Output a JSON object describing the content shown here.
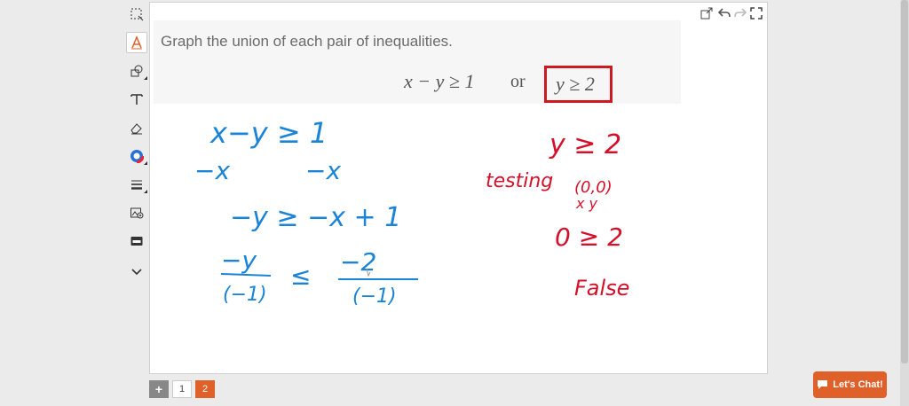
{
  "toolbar": {
    "tools": [
      {
        "name": "select-region-icon"
      },
      {
        "name": "pen-icon",
        "active": true
      },
      {
        "name": "shapes-icon"
      },
      {
        "name": "text-icon"
      },
      {
        "name": "eraser-icon"
      },
      {
        "name": "color-wheel-icon"
      },
      {
        "name": "line-width-icon"
      },
      {
        "name": "insert-image-icon"
      },
      {
        "name": "keyboard-icon"
      },
      {
        "name": "chevron-down-icon"
      }
    ]
  },
  "question": {
    "title": "Graph the union of each pair of inequalities.",
    "left_inequality": "x − y ≥ 1",
    "connector": "or",
    "right_inequality": "y ≥ 2"
  },
  "canvas_icons": [
    "popout-icon",
    "undo-icon",
    "redo-icon",
    "fullscreen-icon"
  ],
  "handwriting": {
    "blue_lines": [
      "x−y ≥ 1",
      "−x",
      "−x",
      "−y ≥ −x + 1",
      "−y",
      "≤",
      "−2",
      "(−1)",
      "(−1)"
    ],
    "red_lines": [
      "y ≥ 2",
      "testing",
      "(0,0)",
      "x y",
      "0 ≥ 2",
      "False"
    ]
  },
  "pager": {
    "add": "+",
    "pages": [
      "1",
      "2"
    ],
    "current": "2"
  },
  "chat": {
    "label": "Let's Chat!"
  },
  "colors": {
    "accent": "#e0602a",
    "ink_blue": "#1b84d6",
    "ink_red": "#d4102a",
    "box_red": "#cc1a22"
  }
}
